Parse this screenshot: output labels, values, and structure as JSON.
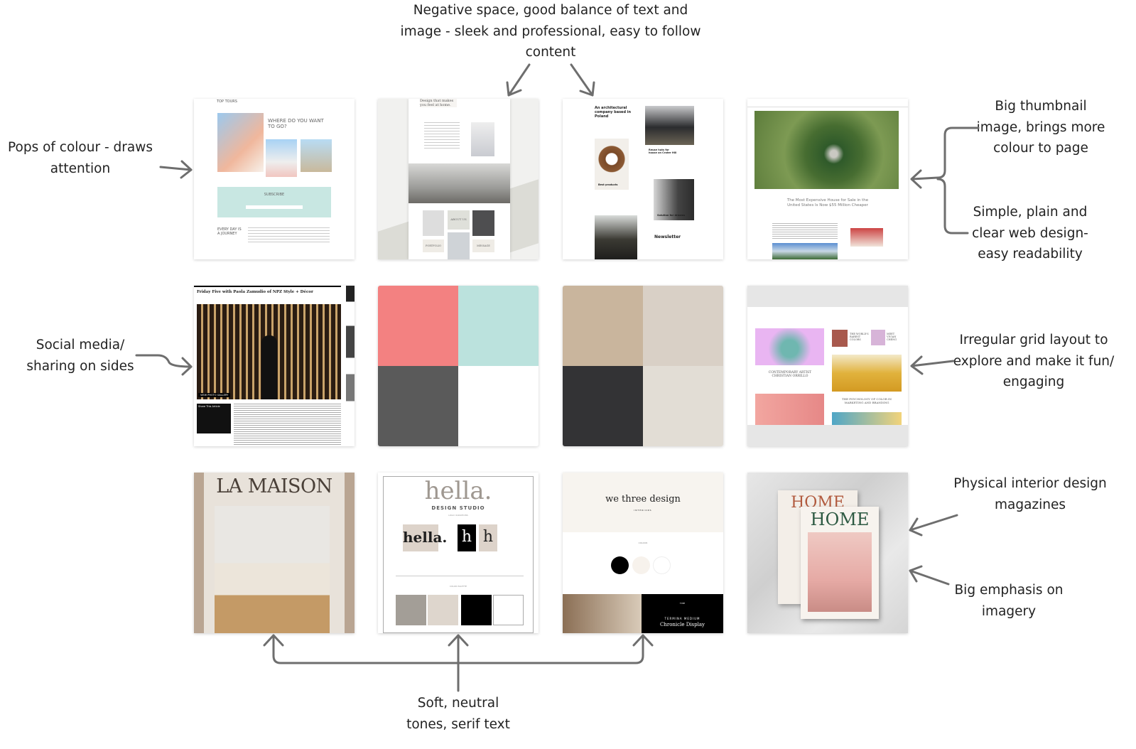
{
  "notes": {
    "top": "Negative space, good balance of text and\nimage - sleek and professional, easy to follow\ncontent",
    "pops": "Pops of colour - draws\nattention",
    "big_thumbnail": "Big thumbnail\nimage, brings more\ncolour to page",
    "simple": "Simple, plain and\nclear web design-\neasy readability",
    "social": "Social media/\nsharing on sides",
    "irregular": "Irregular grid layout to\nexplore and make it fun/\nengaging",
    "magazines": "Physical interior design\nmagazines",
    "imagery": "Big emphasis on\nimagery",
    "soft": "Soft, neutral\ntones, serif text"
  },
  "thumbs": {
    "travel": {
      "brand": "TOP TOURS",
      "heading": "WHERE DO YOU WANT TO GO?",
      "subscribe": "SUBSCRIBE",
      "journey": "EVERY DAY IS A JOURNEY"
    },
    "home": {
      "tagline": "Design that makes you feel at home.",
      "about": "ABOUT US",
      "portfolio": "PORTFOLIO",
      "message": "MESSAGE"
    },
    "arch": {
      "heading": "An architectural company based in Poland",
      "item1": "Reuse huts for house on Crater Hill",
      "item2": "Best products",
      "item3": "Solution for dreams",
      "newsletter": "Newsletter"
    },
    "news": {
      "headline": "The Most Expensive House for Sale in the United States Is Now $55 Million Cheaper"
    },
    "friday": {
      "headline": "Friday Five with Paola Zamudio of NPZ Style + Décor",
      "gallery": "VIEW PHOTO GALLERY",
      "share": "Share This Article"
    },
    "irregular": {
      "item1": "CONTEMPORARY ARTIST CHRISTIAN ORRILLO",
      "item2": "THE WORLD'S RAREST COLORS",
      "item3": "MEET VIVIAN CHENG",
      "item4": "THE PSYCHOLOGY OF COLOR IN MARKETING AND BRANDING"
    },
    "lamaison": {
      "title": "LA MAISON"
    },
    "hella": {
      "logo": "hella.",
      "sub": "DESIGN STUDIO",
      "variations": "LOGO VARIATIONS",
      "palette": "COLOR PALETTE"
    },
    "wethree": {
      "logo": "we three design",
      "sub": "INTERIORS",
      "colour": "COLOUR",
      "type": "TYPE",
      "font1": "TERMINA MEDIUM",
      "font2": "Chronicle Display"
    },
    "magazine": {
      "title": "HOME"
    }
  },
  "palettes": {
    "bright": [
      "#f38181",
      "#bbe2dd",
      "#5a5a5a",
      "#ffffff"
    ],
    "neutral": [
      "#c9b59d",
      "#d9d0c6",
      "#333335",
      "#e2ddd5"
    ]
  },
  "colors": {
    "arrow": "#6e6e6e",
    "text": "#222222"
  }
}
